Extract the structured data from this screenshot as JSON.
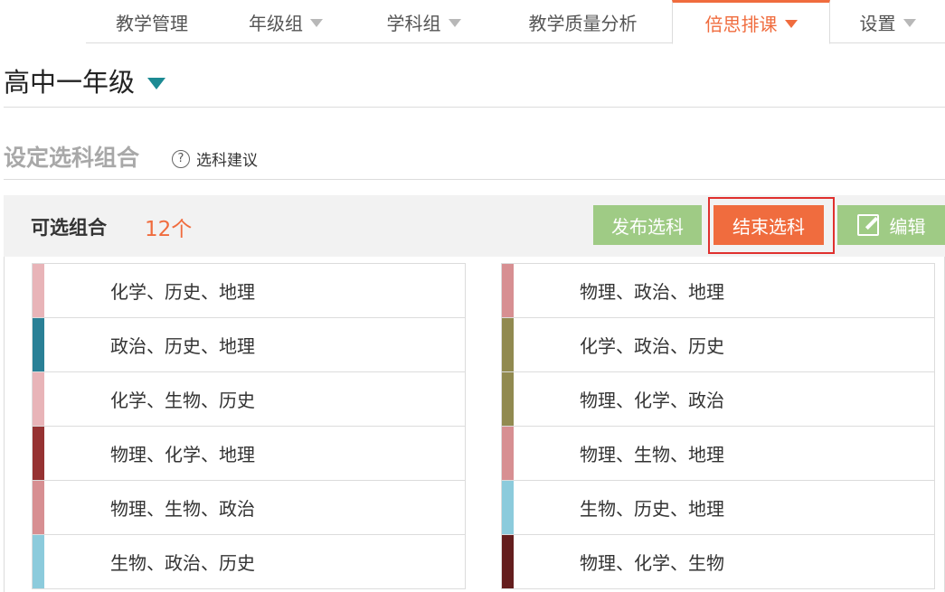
{
  "nav": {
    "tabs": [
      {
        "label": "教学管理",
        "caret": false,
        "active": false
      },
      {
        "label": "年级组",
        "caret": true,
        "active": false
      },
      {
        "label": "学科组",
        "caret": true,
        "active": false
      },
      {
        "label": "教学质量分析",
        "caret": false,
        "active": false
      },
      {
        "label": "倍思排课",
        "caret": true,
        "active": true
      },
      {
        "label": "设置",
        "caret": true,
        "active": false
      }
    ]
  },
  "grade": {
    "label": "高中一年级"
  },
  "section": {
    "title": "设定选科组合",
    "suggest_icon": "?",
    "suggest_label": "选科建议"
  },
  "bar": {
    "label": "可选组合",
    "count": "12个",
    "publish_label": "发布选科",
    "end_label": "结束选科",
    "edit_label": "编辑"
  },
  "combos_left": [
    {
      "text": "化学、历史、地理",
      "color": "#e8b4b8"
    },
    {
      "text": "政治、历史、地理",
      "color": "#2a8096"
    },
    {
      "text": "化学、生物、历史",
      "color": "#e8b4b8"
    },
    {
      "text": "物理、化学、地理",
      "color": "#963232"
    },
    {
      "text": "物理、生物、政治",
      "color": "#d78f92"
    },
    {
      "text": "生物、政治、历史",
      "color": "#8ccbdc"
    }
  ],
  "combos_right": [
    {
      "text": "物理、政治、地理",
      "color": "#d78f92"
    },
    {
      "text": "化学、政治、历史",
      "color": "#918a50"
    },
    {
      "text": "物理、化学、政治",
      "color": "#918a50"
    },
    {
      "text": "物理、生物、地理",
      "color": "#d78f92"
    },
    {
      "text": "生物、历史、地理",
      "color": "#8ccbdc"
    },
    {
      "text": "物理、化学、生物",
      "color": "#641e1e"
    }
  ]
}
